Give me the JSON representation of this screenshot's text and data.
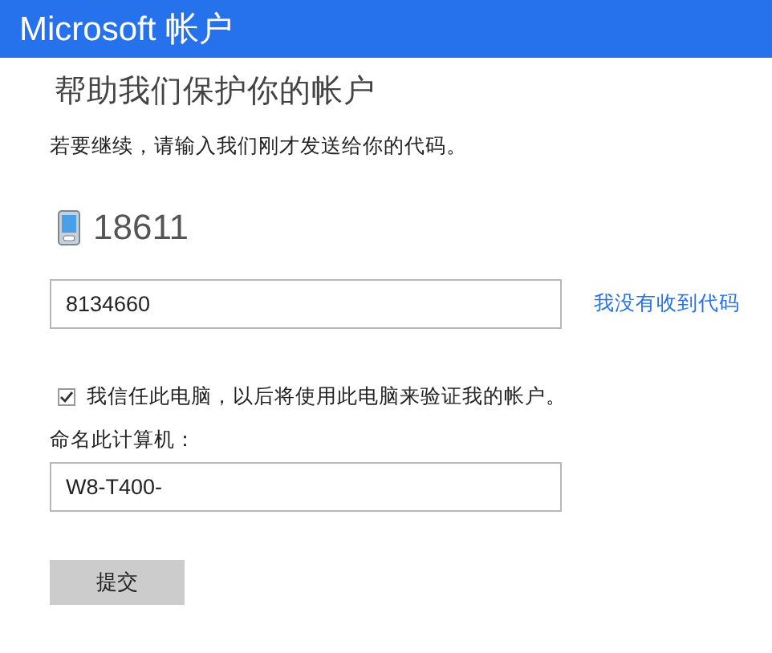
{
  "header": {
    "title": "Microsoft 帐户"
  },
  "heading": "帮助我们保护你的帐户",
  "instruction": "若要继续，请输入我们刚才发送给你的代码。",
  "phone": "18611",
  "code_field": {
    "value": "8134660"
  },
  "no_code_link": "我没有收到代码",
  "trust_checkbox": {
    "label": "我信任此电脑，以后将使用此电脑来验证我的帐户。",
    "checked": true
  },
  "computer_name": {
    "label": "命名此计算机：",
    "value": "W8-T400-"
  },
  "submit_button": "提交"
}
